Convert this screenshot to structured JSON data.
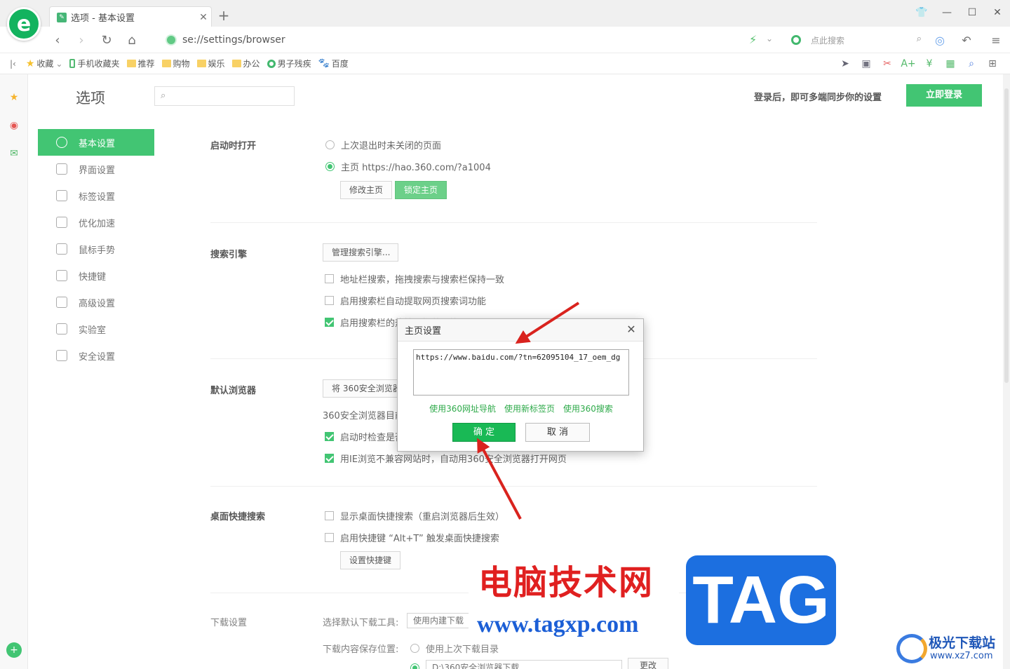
{
  "browser": {
    "tab_title": "选项 - 基本设置",
    "address": "se://settings/browser",
    "search_placeholder": "点此搜索",
    "bookmarks": [
      {
        "label": "收藏",
        "icon": "star-icon"
      },
      {
        "label": "手机收藏夹",
        "icon": "phone-icon"
      },
      {
        "label": "推荐",
        "icon": "folder-icon"
      },
      {
        "label": "购物",
        "icon": "folder-icon"
      },
      {
        "label": "娱乐",
        "icon": "folder-icon"
      },
      {
        "label": "办公",
        "icon": "folder-icon"
      },
      {
        "label": "男子残疾",
        "icon": "360-icon"
      },
      {
        "label": "百度",
        "icon": "baidu-paw-icon"
      }
    ]
  },
  "settings": {
    "title": "选项",
    "sync_text": "登录后，即可多端同步你的设置",
    "login_button": "立即登录",
    "nav": [
      {
        "label": "基本设置",
        "active": true
      },
      {
        "label": "界面设置"
      },
      {
        "label": "标签设置"
      },
      {
        "label": "优化加速"
      },
      {
        "label": "鼠标手势"
      },
      {
        "label": "快捷键"
      },
      {
        "label": "高级设置"
      },
      {
        "label": "实验室"
      },
      {
        "label": "安全设置"
      }
    ],
    "startup": {
      "label": "启动时打开",
      "option1": "上次退出时未关闭的页面",
      "option2": "主页  https://hao.360.com/?a1004",
      "btn_modify": "修改主页",
      "btn_lock": "锁定主页"
    },
    "search_engine": {
      "label": "搜索引擎",
      "btn_manage": "管理搜索引擎...",
      "check1": "地址栏搜索，拖拽搜索与搜索栏保持一致",
      "check2": "启用搜索栏自动提取网页搜索词功能",
      "check3": "启用搜索栏的热搜词推荐功能"
    },
    "default_browser": {
      "label": "默认浏览器",
      "btn": "将 360安全浏览器设为默认浏览器",
      "status": "360安全浏览器目前不是默认浏览器",
      "check1": "启动时检查是否是默认浏览器",
      "check2": "用IE浏览不兼容网站时，自动用360安全浏览器打开网页"
    },
    "desktop_search": {
      "label": "桌面快捷搜索",
      "check1": "显示桌面快捷搜索（重启浏览器后生效）",
      "check2": "启用快捷键 “Alt+T” 触发桌面快捷搜索",
      "btn": "设置快捷键"
    },
    "download": {
      "label": "下载设置",
      "tool_label": "选择默认下载工具:",
      "tool_value": "使用内建下载",
      "path_label": "下载内容保存位置:",
      "path_option1": "使用上次下载目录",
      "path_value": "D:\\360安全浏览器下载",
      "btn_change": "更改"
    }
  },
  "dialog": {
    "title": "主页设置",
    "url_value": "https://www.baidu.com/?tn=62095104_17_oem_dg",
    "links": [
      "使用360网址导航",
      "使用新标签页",
      "使用360搜索"
    ],
    "ok": "确 定",
    "cancel": "取 消"
  },
  "watermark": {
    "site_name": "电脑技术网",
    "site_url": "www.tagxp.com",
    "tag": "TAG",
    "brand2_name": "极光下载站",
    "brand2_url": "www.xz7.com"
  },
  "colors": {
    "accent": "#19b955",
    "arrow": "#d9231e"
  }
}
